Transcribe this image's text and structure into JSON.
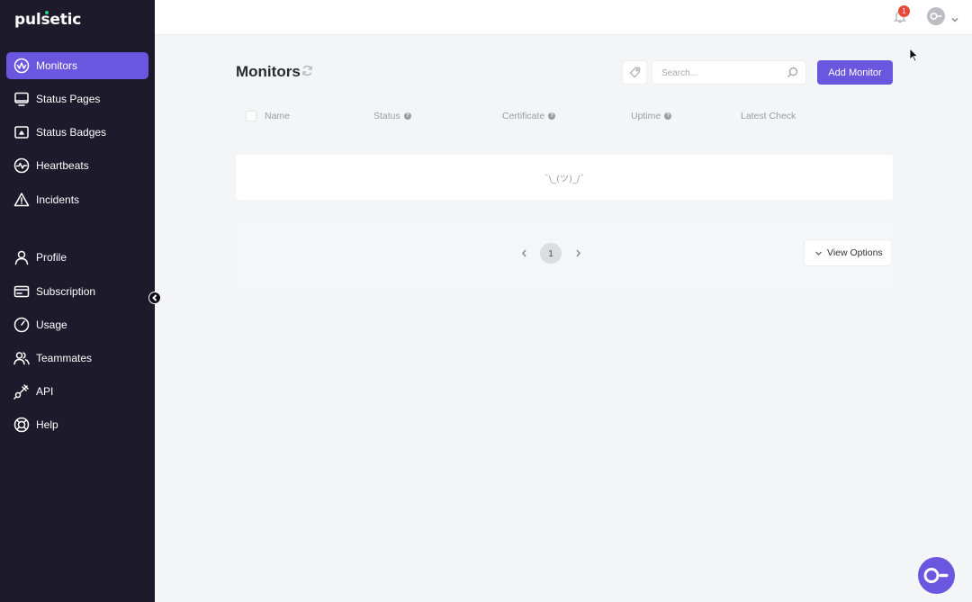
{
  "brand": {
    "name": "pulsetic"
  },
  "sidebar": {
    "items": [
      {
        "label": "Monitors",
        "icon": "monitor-pulse-icon",
        "active": true
      },
      {
        "label": "Status Pages",
        "icon": "screen-icon"
      },
      {
        "label": "Status Badges",
        "icon": "badge-icon"
      },
      {
        "label": "Heartbeats",
        "icon": "heartbeat-icon"
      },
      {
        "label": "Incidents",
        "icon": "warning-triangle-icon"
      },
      {
        "label": "Profile",
        "icon": "user-icon"
      },
      {
        "label": "Subscription",
        "icon": "card-icon"
      },
      {
        "label": "Usage",
        "icon": "gauge-icon"
      },
      {
        "label": "Teammates",
        "icon": "users-icon"
      },
      {
        "label": "API",
        "icon": "plug-icon"
      },
      {
        "label": "Help",
        "icon": "lifebuoy-icon"
      }
    ]
  },
  "topbar": {
    "notification_count": "1"
  },
  "main": {
    "title": "Monitors",
    "search_placeholder": "Search...",
    "add_button": "Add Monitor",
    "columns": [
      "Name",
      "Status",
      "Certificate",
      "Uptime",
      "Latest Check"
    ],
    "empty_text": "¯\\_(ツ)_/¯",
    "pagination": {
      "current_page": "1"
    },
    "view_options": "View Options"
  },
  "colors": {
    "accent": "#6b56e0",
    "sidebar_bg": "#1d1a2b",
    "badge": "#e84a3a"
  }
}
